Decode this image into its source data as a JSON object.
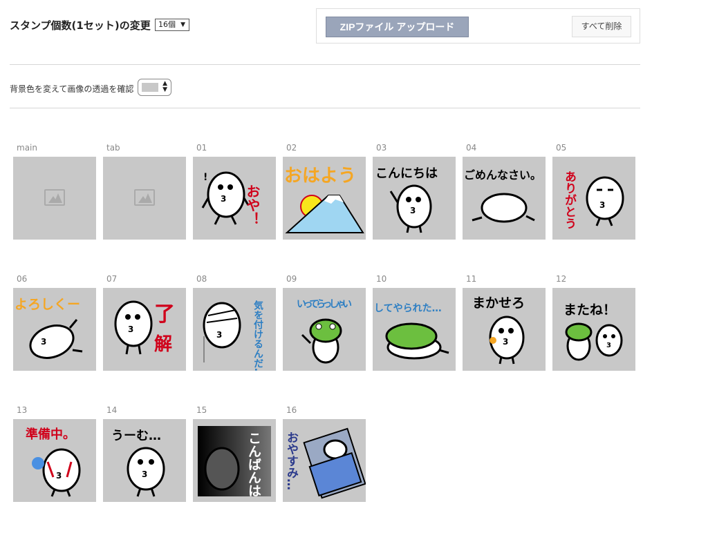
{
  "header": {
    "count_label": "スタンプ個数(1セット)の変更",
    "count_value": "16個",
    "zip_button": "ZIPファイル アップロード",
    "delete_button": "すべて削除"
  },
  "background": {
    "label": "背景色を変えて画像の透過を確認",
    "selected_color": "#c8c8c8"
  },
  "stamps": [
    {
      "label": "main",
      "caption": ""
    },
    {
      "label": "tab",
      "caption": ""
    },
    {
      "label": "01",
      "caption": "おや！"
    },
    {
      "label": "02",
      "caption": "おはよう"
    },
    {
      "label": "03",
      "caption": "こんにちは"
    },
    {
      "label": "04",
      "caption": "ごめんなさい。"
    },
    {
      "label": "05",
      "caption": "ありがとう"
    },
    {
      "label": "06",
      "caption": "よろしくー"
    },
    {
      "label": "07",
      "caption": "了解"
    },
    {
      "label": "08",
      "caption": "気を付けるんだ…"
    },
    {
      "label": "09",
      "caption": "いってらっしゃい"
    },
    {
      "label": "10",
      "caption": "してやられた…"
    },
    {
      "label": "11",
      "caption": "まかせろ"
    },
    {
      "label": "12",
      "caption": "またね！"
    },
    {
      "label": "13",
      "caption": "準備中。"
    },
    {
      "label": "14",
      "caption": "うーむ…"
    },
    {
      "label": "15",
      "caption": "こんばんは"
    },
    {
      "label": "16",
      "caption": "おやすみ…"
    }
  ]
}
